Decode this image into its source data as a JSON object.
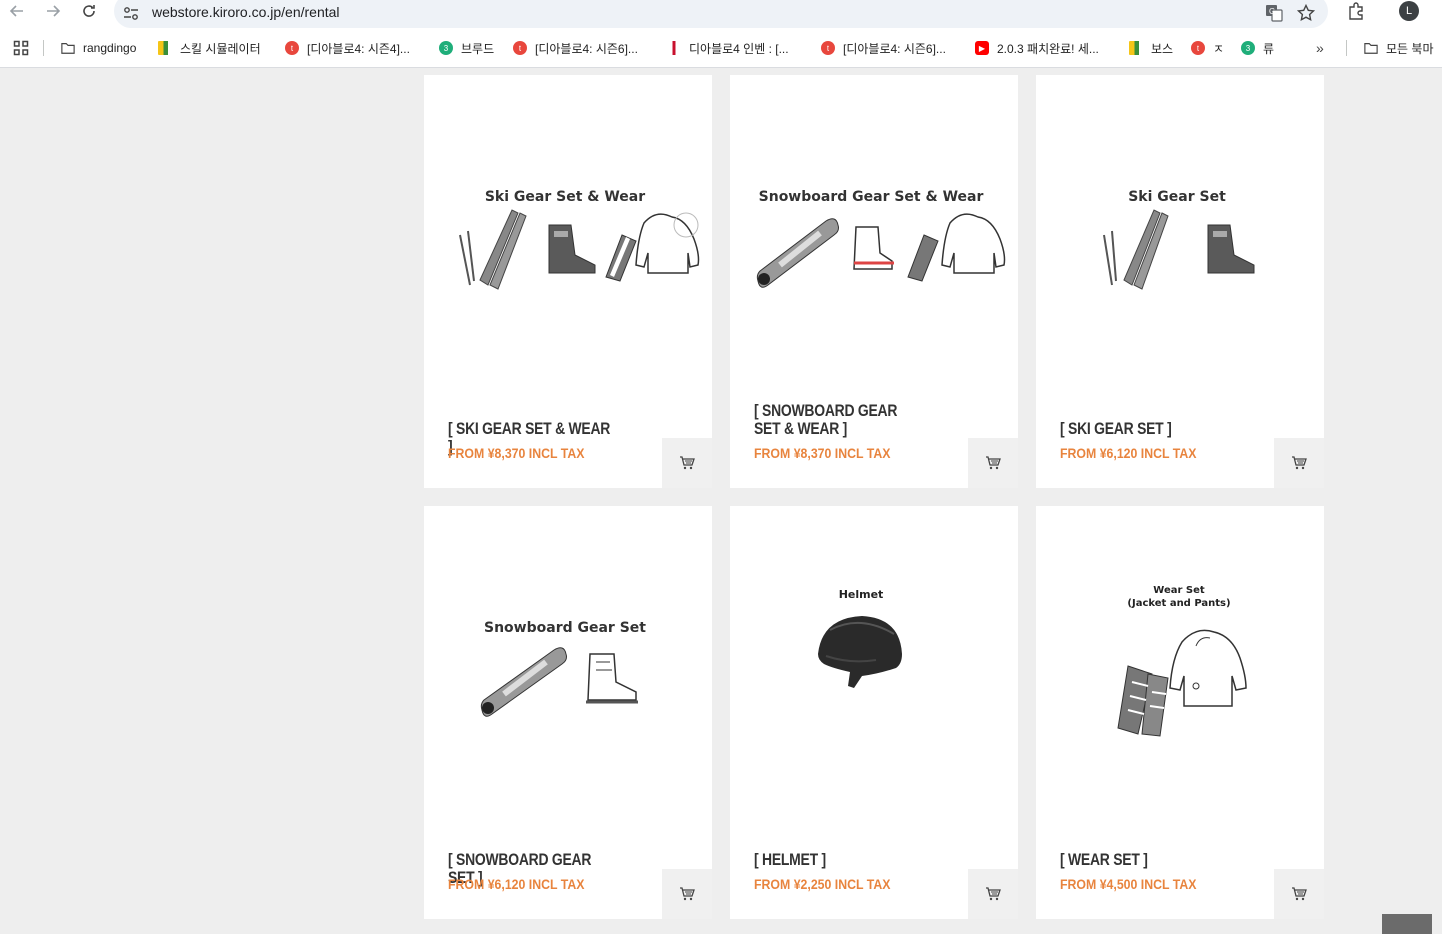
{
  "browser": {
    "url": "webstore.kiroro.co.jp/en/rental",
    "profile_initial": "L",
    "bookmarks": [
      {
        "label": "rangdingo",
        "icon": "folder-icon"
      },
      {
        "label": "스킬 시뮬레이터",
        "icon": "bookmark-favicon"
      },
      {
        "label": "[디아블로4: 시즌4]...",
        "icon": "bookmark-favicon"
      },
      {
        "label": "브루드",
        "icon": "bookmark-favicon"
      },
      {
        "label": "[디아블로4: 시즌6]...",
        "icon": "bookmark-favicon"
      },
      {
        "label": "디아블로4 인벤 : [...",
        "icon": "bookmark-favicon"
      },
      {
        "label": "[디아블로4: 시즌6]...",
        "icon": "bookmark-favicon"
      },
      {
        "label": "2.0.3 패치완료! 세...",
        "icon": "youtube-icon"
      },
      {
        "label": "보스",
        "icon": "bookmark-favicon"
      },
      {
        "label": "ㅈ",
        "icon": "bookmark-favicon"
      },
      {
        "label": "류",
        "icon": "bookmark-favicon"
      }
    ],
    "more_label": "»",
    "all_bookmarks_label": "모든 북마"
  },
  "products": [
    {
      "name": "[ SKI GEAR SET & WEAR ]",
      "price": "FROM ¥8,370 INCL TAX",
      "image_title": "Ski Gear Set  & Wear",
      "image_subtitle": ""
    },
    {
      "name": "[ SNOWBOARD GEAR SET & WEAR ]",
      "price": "FROM ¥8,370 INCL TAX",
      "image_title": "Snowboard Gear Set & Wear",
      "image_subtitle": ""
    },
    {
      "name": "[ SKI GEAR SET ]",
      "price": "FROM ¥6,120 INCL TAX",
      "image_title": "Ski Gear Set",
      "image_subtitle": ""
    },
    {
      "name": "[ SNOWBOARD GEAR SET ]",
      "price": "FROM ¥6,120 INCL TAX",
      "image_title": "Snowboard Gear Set",
      "image_subtitle": ""
    },
    {
      "name": "[ HELMET ]",
      "price": "FROM ¥2,250 INCL TAX",
      "image_title": "Helmet",
      "image_subtitle": ""
    },
    {
      "name": "[ WEAR SET ]",
      "price": "FROM ¥4,500 INCL TAX",
      "image_title": "Wear Set",
      "image_subtitle": "(Jacket and Pants)"
    }
  ],
  "colors": {
    "price": "#e8843e",
    "page_bg": "#eeeeee",
    "cart_bg": "#f0f0f0"
  }
}
